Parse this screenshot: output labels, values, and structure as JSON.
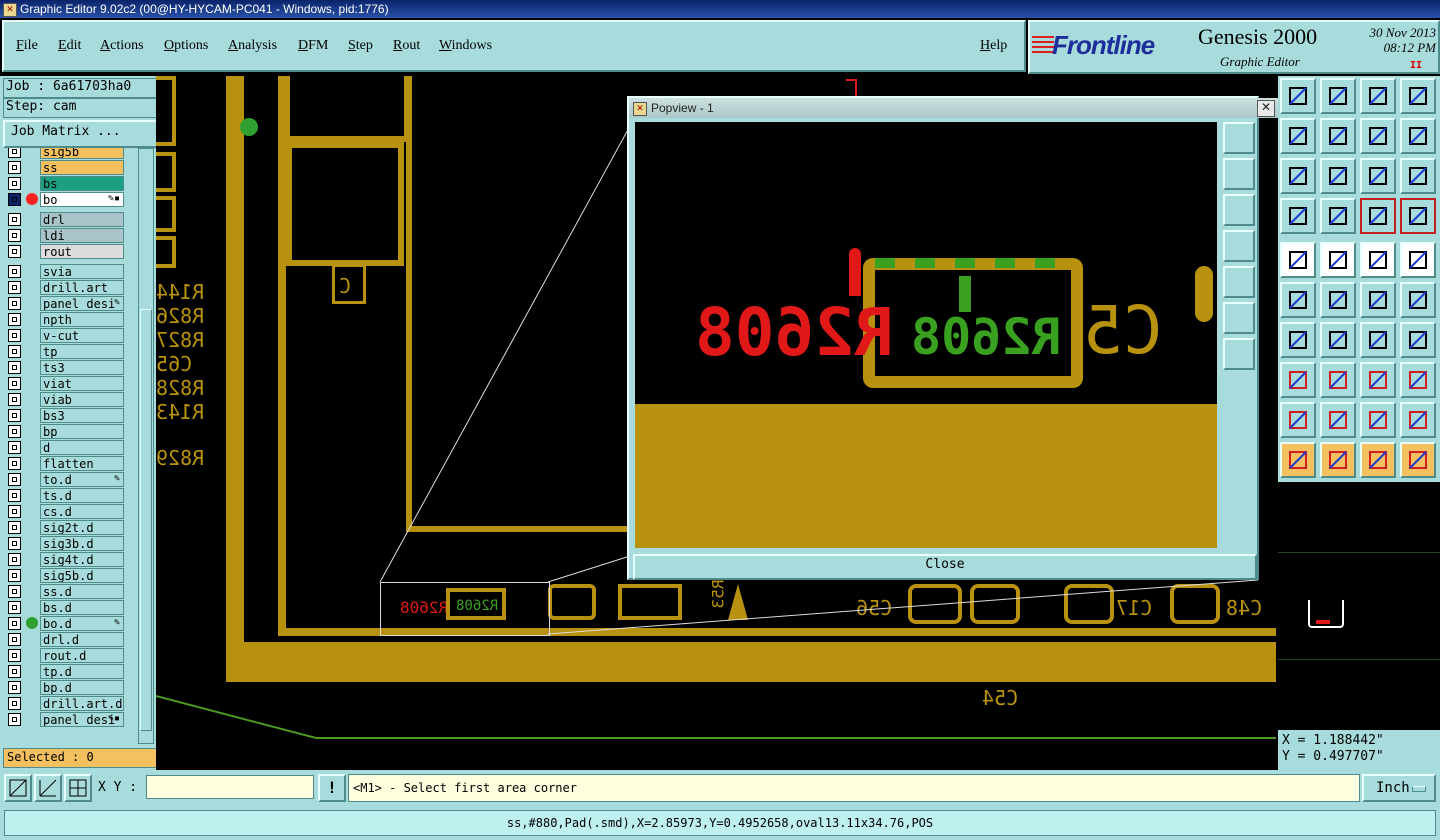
{
  "window": {
    "title": "Graphic Editor 9.02c2 (00@HY-HYCAM-PC041 - Windows, pid:1776)"
  },
  "menu": {
    "items": [
      "File",
      "Edit",
      "Actions",
      "Options",
      "Analysis",
      "DFM",
      "Step",
      "Rout",
      "Windows"
    ],
    "help": "Help"
  },
  "brand": {
    "logo": "Frontline",
    "product": "Genesis 2000",
    "subtitle": "Graphic Editor",
    "date": "30 Nov 2013",
    "time": "08:12 PM",
    "pause": "II"
  },
  "left": {
    "job": "Job : 6a61703ha0",
    "step": "Step: cam",
    "job_matrix": "Job Matrix ...",
    "selected": "Selected : 0",
    "layers": [
      {
        "name": "sig5b",
        "color": "#f4c060"
      },
      {
        "name": "ss",
        "color": "#f4c060"
      },
      {
        "name": "bs",
        "color": "#1aa080"
      },
      {
        "name": "bo",
        "color": "#ffffff",
        "dot": "#ff2020",
        "mark": "✎▪",
        "active": true
      },
      {
        "name": "drl",
        "color": "#a8c4c8",
        "gap": true
      },
      {
        "name": "ldi",
        "color": "#a8c4c8"
      },
      {
        "name": "rout",
        "color": "#dcdcdc"
      },
      {
        "name": "svia",
        "color": "#a8dcdc",
        "gap": true
      },
      {
        "name": "drill.art",
        "color": "#a8dcdc"
      },
      {
        "name": "panel_desi",
        "color": "#a8dcdc",
        "mark": "✎"
      },
      {
        "name": "npth",
        "color": "#a8dcdc"
      },
      {
        "name": "v-cut",
        "color": "#a8dcdc"
      },
      {
        "name": "tp",
        "color": "#a8dcdc"
      },
      {
        "name": "ts3",
        "color": "#a8dcdc"
      },
      {
        "name": "viat",
        "color": "#a8dcdc"
      },
      {
        "name": "viab",
        "color": "#a8dcdc"
      },
      {
        "name": "bs3",
        "color": "#a8dcdc"
      },
      {
        "name": "bp",
        "color": "#a8dcdc"
      },
      {
        "name": "d",
        "color": "#a8dcdc"
      },
      {
        "name": "flatten",
        "color": "#a8dcdc"
      },
      {
        "name": "to.d",
        "color": "#a8dcdc",
        "mark": "✎"
      },
      {
        "name": "ts.d",
        "color": "#a8dcdc"
      },
      {
        "name": "cs.d",
        "color": "#a8dcdc"
      },
      {
        "name": "sig2t.d",
        "color": "#a8dcdc"
      },
      {
        "name": "sig3b.d",
        "color": "#a8dcdc"
      },
      {
        "name": "sig4t.d",
        "color": "#a8dcdc"
      },
      {
        "name": "sig5b.d",
        "color": "#a8dcdc"
      },
      {
        "name": "ss.d",
        "color": "#a8dcdc"
      },
      {
        "name": "bs.d",
        "color": "#a8dcdc"
      },
      {
        "name": "bo.d",
        "color": "#a8dcdc",
        "dot": "#30a030",
        "mark": "✎"
      },
      {
        "name": "drl.d",
        "color": "#a8dcdc"
      },
      {
        "name": "rout.d",
        "color": "#a8dcdc"
      },
      {
        "name": "tp.d",
        "color": "#a8dcdc"
      },
      {
        "name": "bp.d",
        "color": "#a8dcdc"
      },
      {
        "name": "drill.art.d",
        "color": "#a8dcdc"
      },
      {
        "name": "panel_desi",
        "color": "#a8dcdc",
        "mark": "✎▪"
      }
    ]
  },
  "canvas": {
    "silk_left": [
      "R144",
      "R826",
      "R827",
      "C65",
      "R828",
      "R143",
      "R829"
    ],
    "silk_bottom": [
      "C56",
      "C17",
      "C48",
      "C54",
      "C5",
      "R53"
    ],
    "colors": {
      "copper": "#b8920e",
      "red": "#e01818",
      "green": "#3aa020",
      "trace": "#4a9a20"
    }
  },
  "popview": {
    "title": "Popview - 1",
    "close_x": "✕",
    "close": "Close",
    "labels": {
      "red_text": "R2608",
      "green_text": "R2608",
      "silk": "C5"
    }
  },
  "coords": {
    "x": "X = 1.188442\"",
    "y": "Y = 0.497707\""
  },
  "bottom": {
    "xy_label": "X Y :",
    "xy_value": "",
    "prompt": "<M1> - Select first area corner",
    "units": "Inch",
    "alert": "!"
  },
  "status": {
    "text": "ss,#880,Pad(.smd),X=2.85973,Y=0.4952658,oval13.11x34.76,POS"
  }
}
